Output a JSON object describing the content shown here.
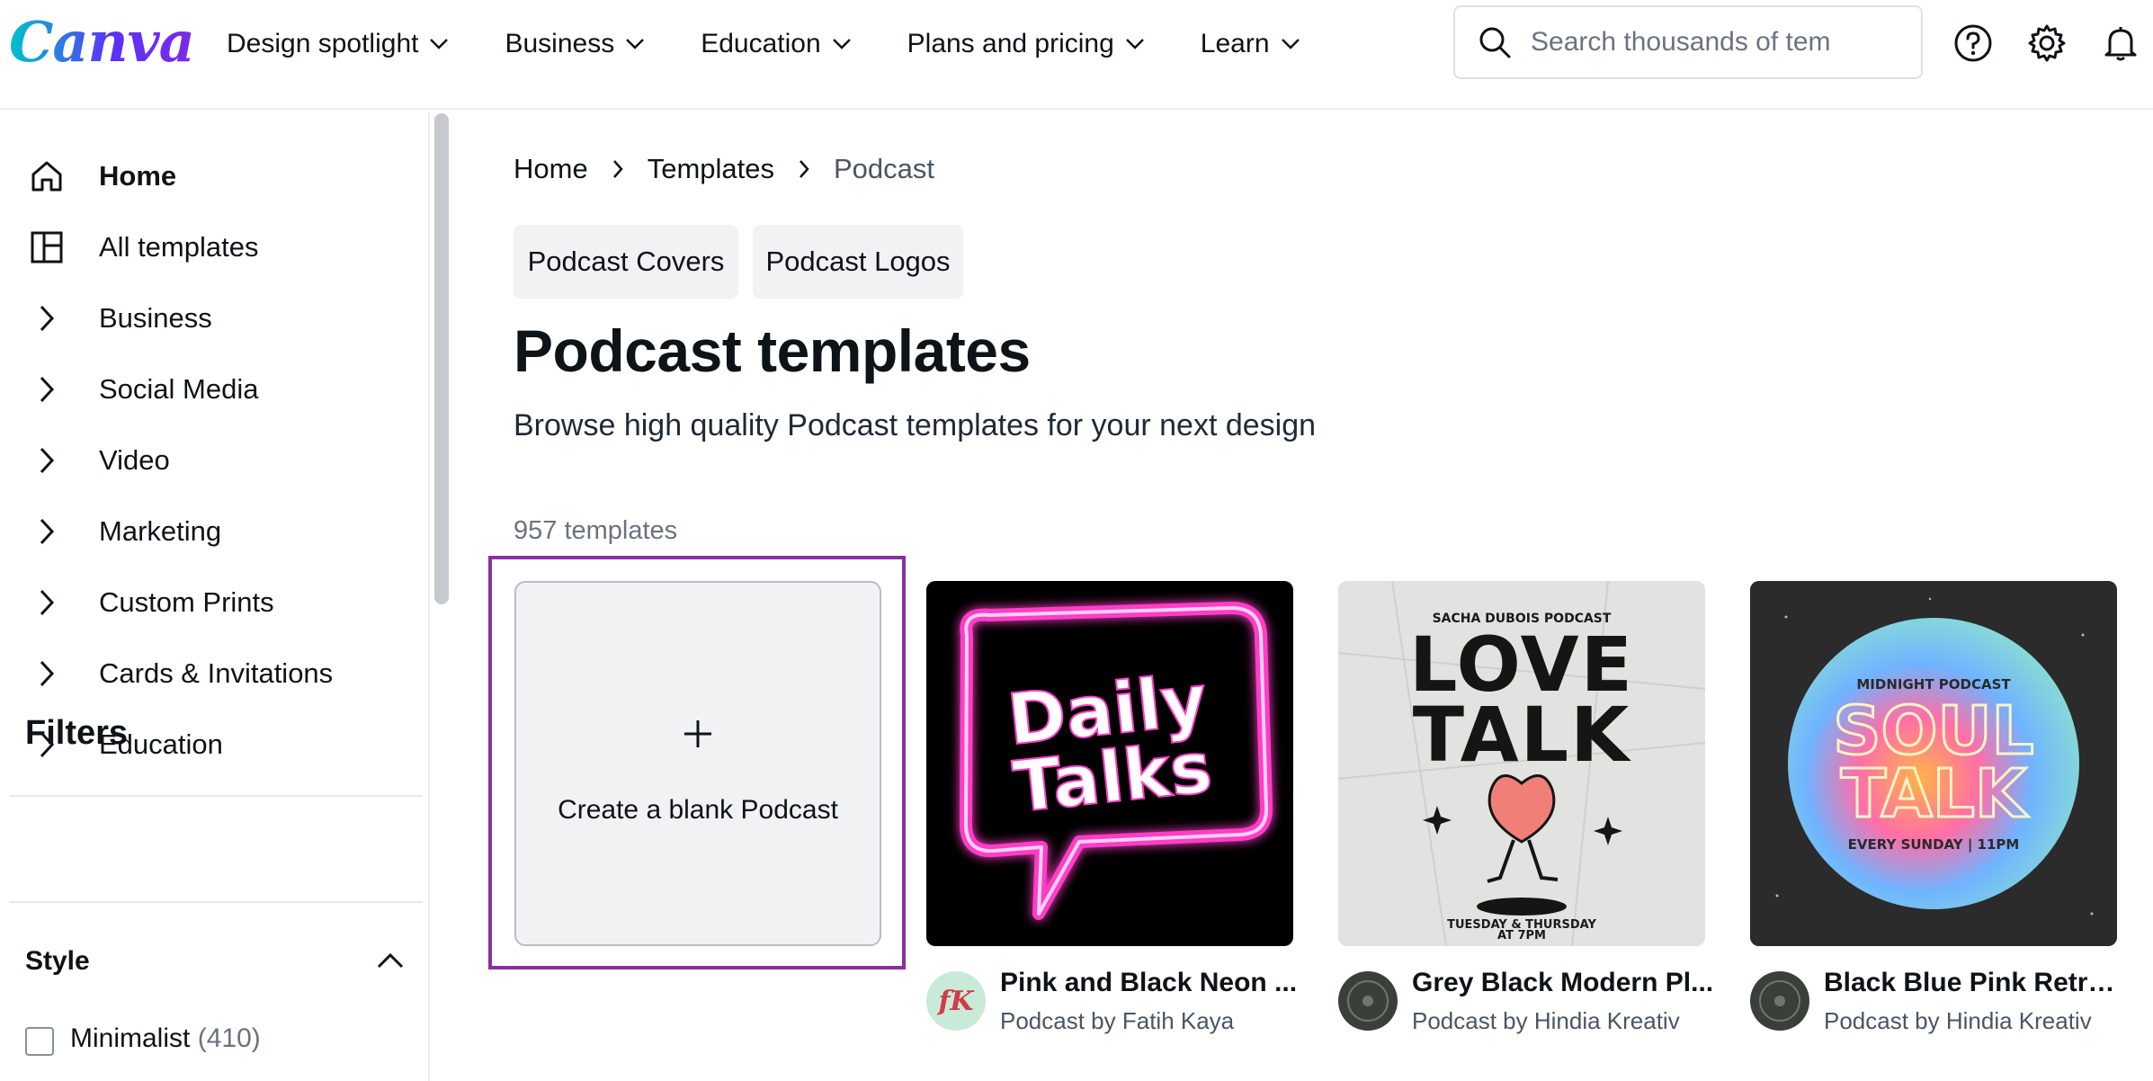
{
  "header": {
    "logo": "Canva",
    "nav": [
      {
        "label": "Design spotlight"
      },
      {
        "label": "Business"
      },
      {
        "label": "Education"
      },
      {
        "label": "Plans and pricing"
      },
      {
        "label": "Learn"
      }
    ],
    "search": {
      "placeholder": "Search thousands of tem"
    },
    "icons": [
      "help-icon",
      "settings-gear-icon",
      "notification-bell-icon"
    ]
  },
  "sidebar": {
    "items": [
      {
        "label": "Home",
        "icon": "home-icon"
      },
      {
        "label": "All templates",
        "icon": "templates-layout-icon"
      },
      {
        "label": "Business",
        "icon": "chevron-right-icon"
      },
      {
        "label": "Social Media",
        "icon": "chevron-right-icon"
      },
      {
        "label": "Video",
        "icon": "chevron-right-icon"
      },
      {
        "label": "Marketing",
        "icon": "chevron-right-icon"
      },
      {
        "label": "Custom Prints",
        "icon": "chevron-right-icon"
      },
      {
        "label": "Cards & Invitations",
        "icon": "chevron-right-icon"
      },
      {
        "label": "Education",
        "icon": "chevron-right-icon"
      }
    ],
    "filters_title": "Filters",
    "style_title": "Style",
    "style_options": [
      {
        "label": "Minimalist",
        "count": "(410)",
        "checked": false
      }
    ]
  },
  "main": {
    "breadcrumb": [
      "Home",
      "Templates",
      "Podcast"
    ],
    "chips": [
      "Podcast Covers",
      "Podcast Logos"
    ],
    "title": "Podcast templates",
    "subtitle": "Browse high quality Podcast templates for your next design",
    "count": "957 templates",
    "blank_card": {
      "label": "Create a blank Podcast"
    },
    "templates": [
      {
        "name": "Pink and Black Neon ...",
        "author": "Podcast by Fatih Kaya",
        "avatar_text": "fK",
        "art": [
          "Daily",
          "Talks"
        ]
      },
      {
        "name": "Grey Black Modern Pl...",
        "author": "Podcast by Hindia Kreativ",
        "art": [
          "SACHA DUBOIS PODCAST",
          "LOVE",
          "TALK",
          "TUESDAY & THURSDAY",
          "AT 7PM"
        ]
      },
      {
        "name": "Black Blue Pink Retro ...",
        "author": "Podcast by Hindia Kreativ",
        "art": [
          "MIDNIGHT PODCAST",
          "SOUL",
          "TALK",
          "EVERY SUNDAY | 11PM"
        ]
      }
    ]
  },
  "colors": {
    "selection_outline": "#8b2f9f",
    "neon_pink": "#ff3ec8",
    "chip_bg": "#f1f2f4"
  }
}
